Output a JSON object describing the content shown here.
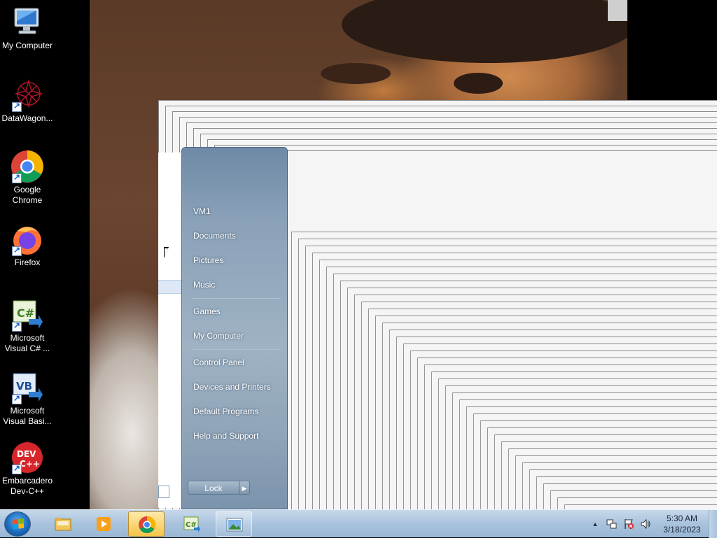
{
  "desktop": {
    "icons": [
      {
        "label": "My Computer",
        "icon": "computer-icon"
      },
      {
        "label": "DataWagon...",
        "icon": "datawagon-icon"
      },
      {
        "label": "Google Chrome",
        "icon": "chrome-icon"
      },
      {
        "label": "Firefox",
        "icon": "firefox-icon"
      },
      {
        "label": "Microsoft Visual C# ...",
        "icon": "visual-csharp-icon"
      },
      {
        "label": "Microsoft Visual Basi...",
        "icon": "visual-basic-icon"
      },
      {
        "label": "Embarcadero Dev-C++",
        "icon": "devcpp-icon"
      }
    ]
  },
  "start_menu": {
    "items": [
      {
        "label": "VM1"
      },
      {
        "label": "Documents"
      },
      {
        "label": "Pictures"
      },
      {
        "label": "Music"
      },
      {
        "label": "Games"
      },
      {
        "label": "My Computer"
      },
      {
        "label": "Control Panel"
      },
      {
        "label": "Devices and Printers"
      },
      {
        "label": "Default Programs"
      },
      {
        "label": "Help and Support"
      }
    ],
    "lock_label": "Lock",
    "lock_arrow": "▶"
  },
  "taskbar": {
    "buttons": [
      {
        "icon": "file-explorer-icon"
      },
      {
        "icon": "media-player-icon"
      },
      {
        "icon": "chrome-icon"
      },
      {
        "icon": "visual-csharp-icon"
      },
      {
        "icon": "picture-viewer-icon"
      }
    ],
    "tray": {
      "expand_glyph": "▲",
      "time": "5:30 AM",
      "date": "3/18/2023"
    }
  },
  "colors": {
    "taskbar": "#a9c3dd",
    "start_menu_panel": "#8aa1b8",
    "active_button": "#f5c54a"
  }
}
